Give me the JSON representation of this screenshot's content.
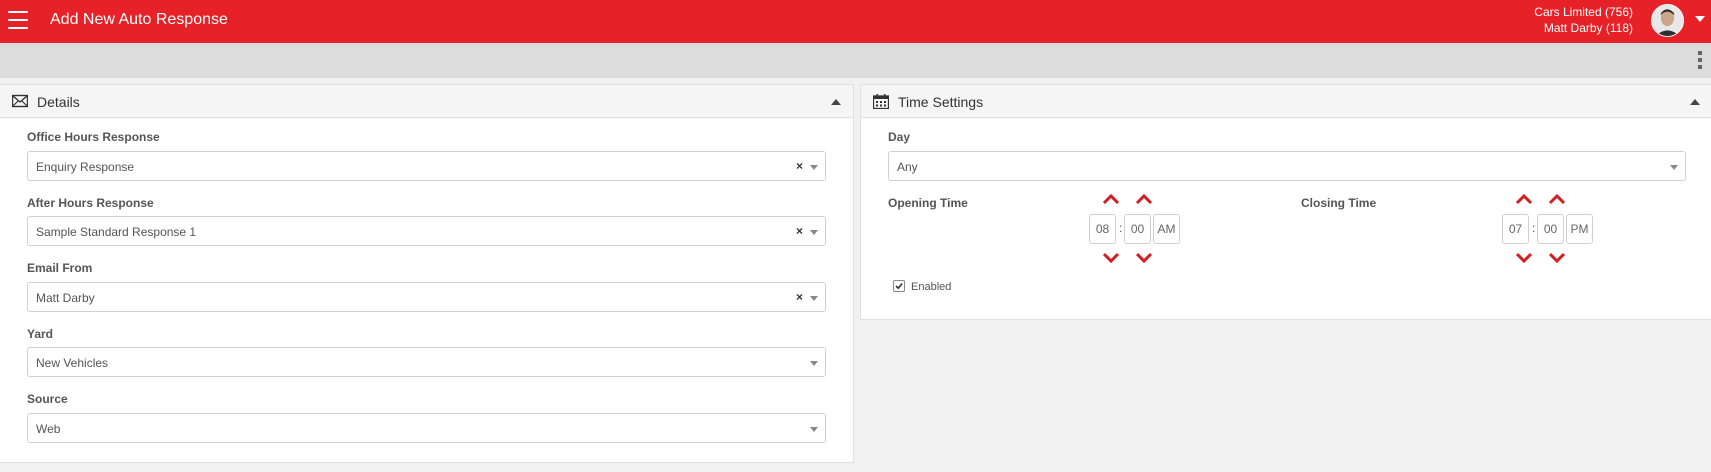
{
  "header": {
    "title": "Add New Auto Response",
    "company": "Cars Limited (756)",
    "user": "Matt Darby (118)"
  },
  "details": {
    "title": "Details",
    "fields": [
      {
        "label": "Office Hours Response",
        "value": "Enquiry Response"
      },
      {
        "label": "After Hours Response",
        "value": "Sample Standard Response 1"
      },
      {
        "label": "Email From",
        "value": "Matt Darby"
      },
      {
        "label": "Yard",
        "value": "New Vehicles"
      },
      {
        "label": "Source",
        "value": "Web"
      }
    ],
    "clear_symbol": "×"
  },
  "time_settings": {
    "title": "Time Settings",
    "day_label": "Day",
    "day_value": "Any",
    "opening": {
      "label": "Opening Time",
      "hour": "08",
      "minute": "00",
      "meridian": "AM"
    },
    "closing": {
      "label": "Closing Time",
      "hour": "07",
      "minute": "00",
      "meridian": "PM"
    },
    "separator": ":",
    "enabled_label": "Enabled",
    "enabled": true
  },
  "colors": {
    "brand": "#e62228",
    "arrow": "#d21f1f"
  }
}
